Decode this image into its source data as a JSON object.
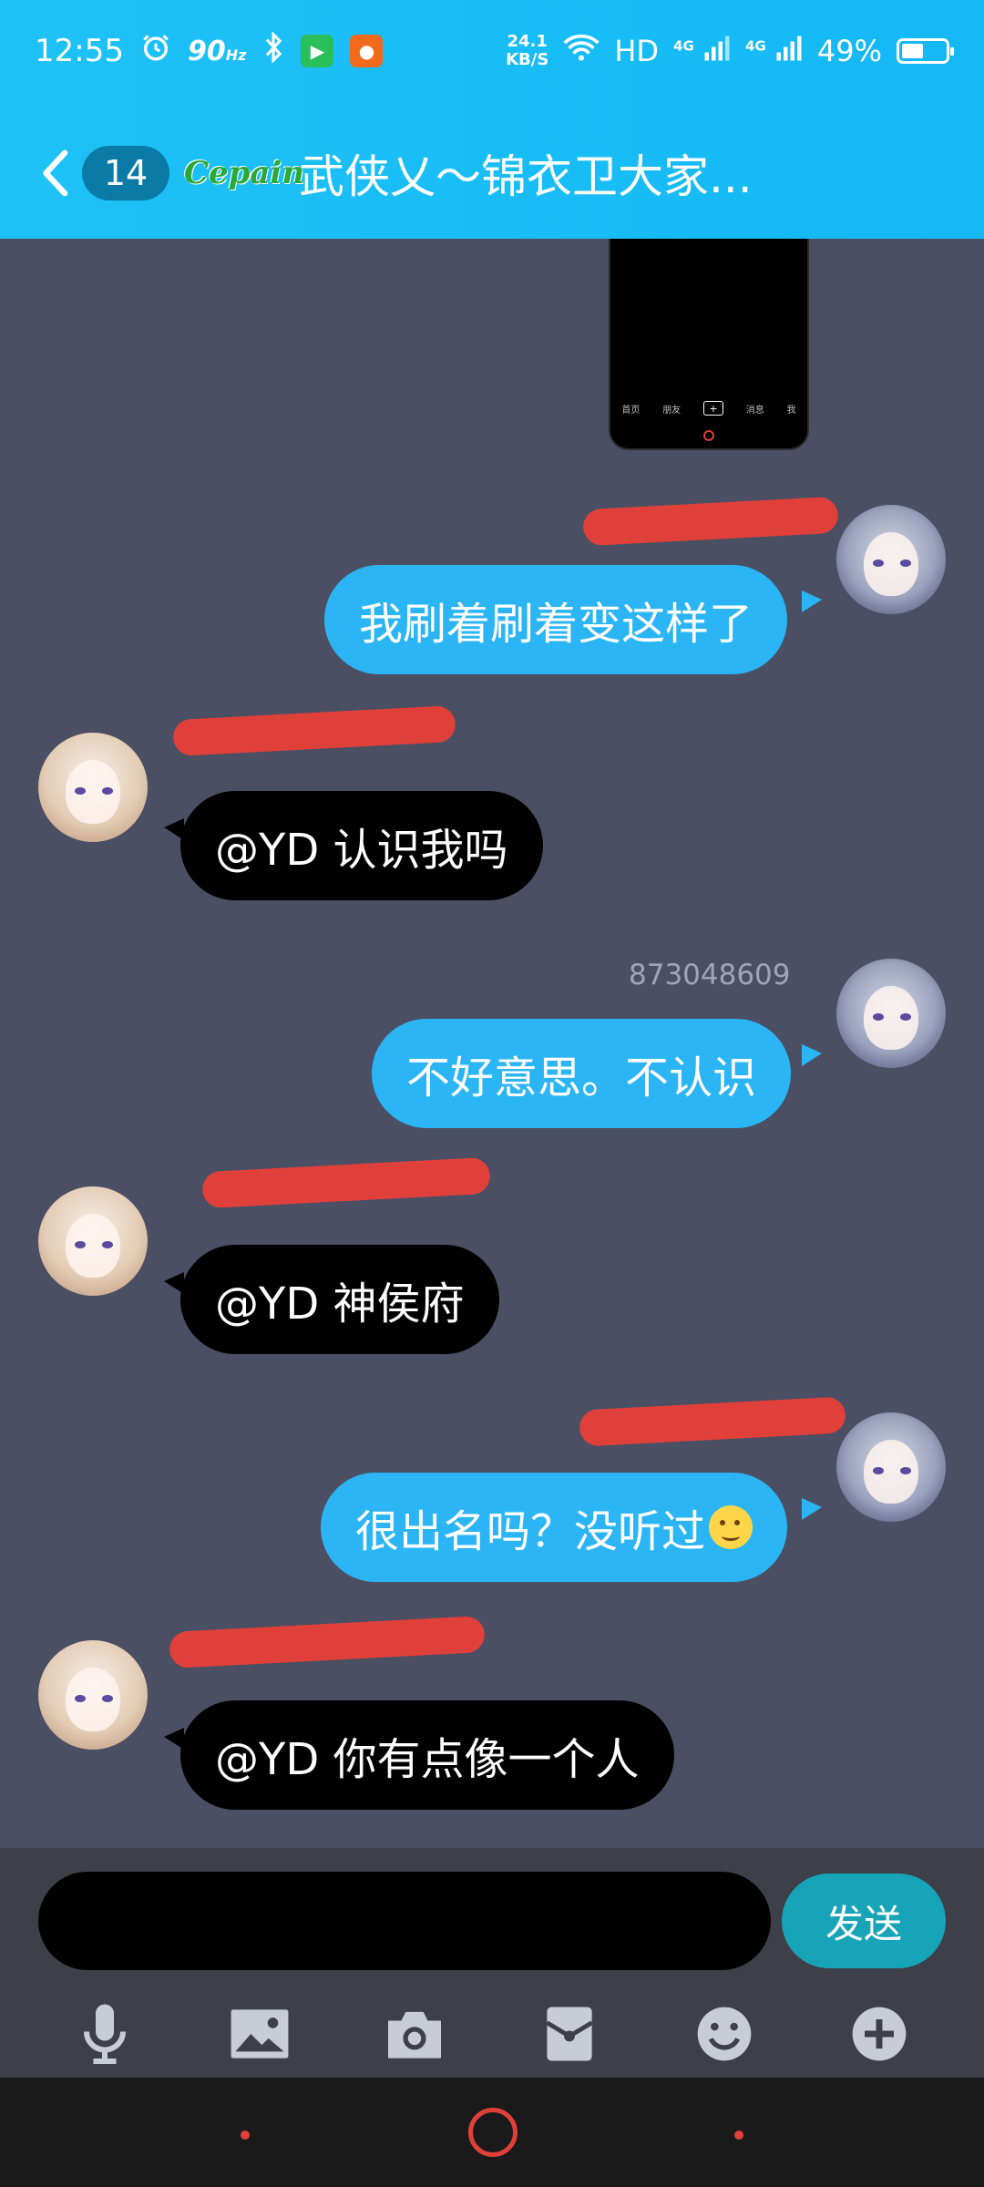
{
  "status_bar": {
    "time": "12:55",
    "refresh_rate": "90",
    "refresh_unit": "Hz",
    "net_speed_value": "24.1",
    "net_speed_unit": "KB/S",
    "hd_label": "HD",
    "net_type_1": "4G",
    "net_type_2": "4G",
    "battery_percent": "49%",
    "battery_level": 0.49
  },
  "header": {
    "back_count": "14",
    "group_logo_text": "Cepain",
    "title": "武侠乂～锦衣卫大家..."
  },
  "shared_screenshot": {
    "nav_items": [
      "首页",
      "朋友",
      "+",
      "消息",
      "我"
    ]
  },
  "messages": [
    {
      "side": "me",
      "sender": "",
      "text": "我刷着刷着变这样了"
    },
    {
      "side": "other",
      "sender": "",
      "text": "@YD 认识我吗"
    },
    {
      "side": "me",
      "sender": "873048609",
      "text": "不好意思。不认识"
    },
    {
      "side": "other",
      "sender": "",
      "text": "@YD 神侯府"
    },
    {
      "side": "me",
      "sender": "",
      "text": "很出名吗？没听过"
    },
    {
      "side": "other",
      "sender": "",
      "text": "@YD 你有点像一个人"
    }
  ],
  "input": {
    "value": "",
    "placeholder": "",
    "send_label": "发送"
  },
  "colors": {
    "header": "#1fc2f6",
    "bubble_me": "#2cb5f4",
    "bubble_other": "#000000",
    "chat_bg": "#4a4f63",
    "send_button": "#17a3b8"
  }
}
